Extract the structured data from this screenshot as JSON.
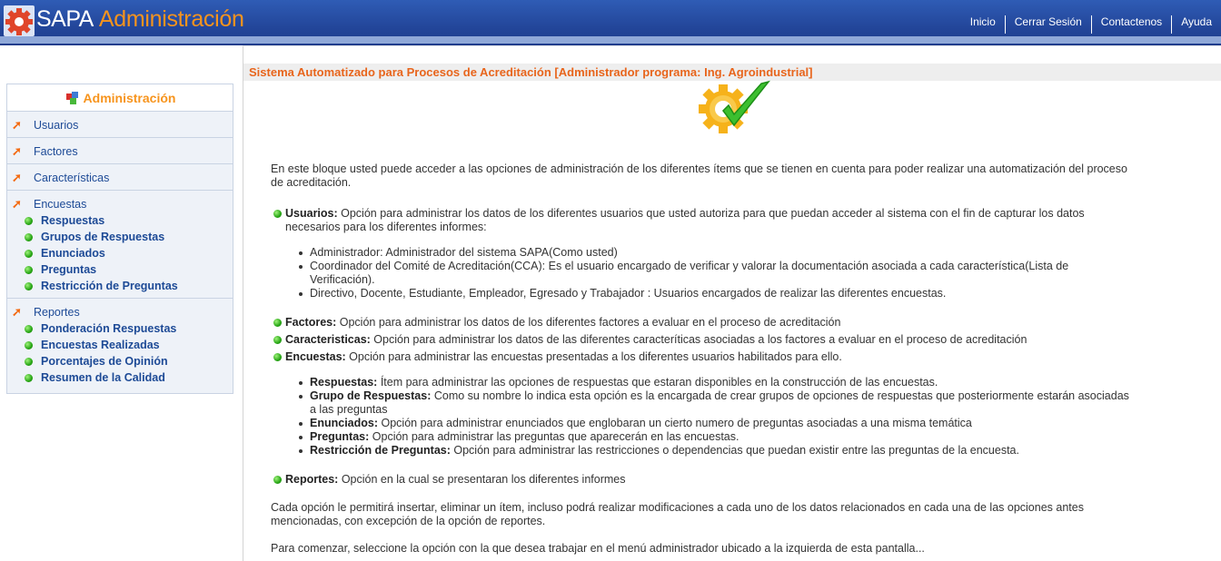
{
  "header": {
    "brand_main": "SAPA",
    "brand_sub": "Administración",
    "nav": [
      "Inicio",
      "Cerrar Sesión",
      "Contactenos",
      "Ayuda"
    ]
  },
  "sidebar": {
    "title": "Administración",
    "items": [
      {
        "label": "Usuarios"
      },
      {
        "label": "Factores"
      },
      {
        "label": "Características"
      },
      {
        "label": "Encuestas",
        "children": [
          "Respuestas",
          "Grupos de Respuestas",
          "Enunciados",
          "Preguntas",
          "Restricción de Preguntas"
        ]
      },
      {
        "label": "Reportes",
        "children": [
          "Ponderación Respuestas",
          "Encuestas Realizadas",
          "Porcentajes de Opinión",
          "Resumen de la Calidad"
        ]
      }
    ]
  },
  "main": {
    "title": "Sistema Automatizado para Procesos de Acreditación [Administrador programa: Ing. Agroindustrial]",
    "intro": "En este bloque usted puede acceder a las opciones de administración de los diferentes ítems que se tienen en cuenta para poder realizar una automatización del proceso de acreditación.",
    "usuarios": {
      "label": "Usuarios:",
      "text": " Opción para administrar los datos de los diferentes usuarios que usted autoriza para que puedan acceder al sistema con el fin de capturar los datos necesarios para los diferentes informes:",
      "list": [
        "Administrador: Administrador del sistema SAPA(Como usted)",
        "Coordinador del Comité de Acreditación(CCA): Es el usuario encargado de verificar y valorar la documentación asociada a cada característica(Lista de Verificación).",
        "Directivo, Docente, Estudiante, Empleador, Egresado y Trabajador : Usuarios encargados de realizar las diferentes encuestas."
      ]
    },
    "factores": {
      "label": "Factores:",
      "text": " Opción para administrar los datos de los diferentes factores a evaluar en el proceso de acreditación"
    },
    "caracteristicas": {
      "label": "Caracteristicas:",
      "text": " Opción para administrar los datos de las diferentes caracteríticas asociadas a los factores a evaluar en el proceso de acreditación"
    },
    "encuestas": {
      "label": "Encuestas:",
      "text": " Opción para administrar las encuestas presentadas a los diferentes usuarios habilitados para ello.",
      "list": [
        {
          "label": "Respuestas:",
          "text": " Ítem para administrar las opciones de respuestas que estaran disponibles en la construcción de las encuestas."
        },
        {
          "label": "Grupo de Respuestas:",
          "text": " Como su nombre lo indica esta opción es la encargada de crear grupos de opciones de respuestas que posteriormente estarán asociadas a las preguntas"
        },
        {
          "label": "Enunciados:",
          "text": " Opción para administrar enunciados que englobaran un cierto numero de preguntas asociadas a una misma temática"
        },
        {
          "label": "Preguntas:",
          "text": " Opción para administrar las preguntas que aparecerán en las encuestas."
        },
        {
          "label": "Restricción de Preguntas:",
          "text": " Opción para administrar las restricciones o dependencias que puedan existir entre las preguntas de la encuesta."
        }
      ]
    },
    "reportes": {
      "label": "Reportes:",
      "text": " Opción en la cual se presentaran los diferentes informes"
    },
    "outro1": "Cada opción le permitirá insertar, eliminar un ítem, incluso podrá realizar modificaciones a cada uno de los datos relacionados en cada una de las opciones antes mencionadas, con excepción de la opción de reportes.",
    "outro2": "Para comenzar, seleccione la opción con la que desea trabajar en el menú administrador ubicado a la izquierda de esta pantalla..."
  }
}
